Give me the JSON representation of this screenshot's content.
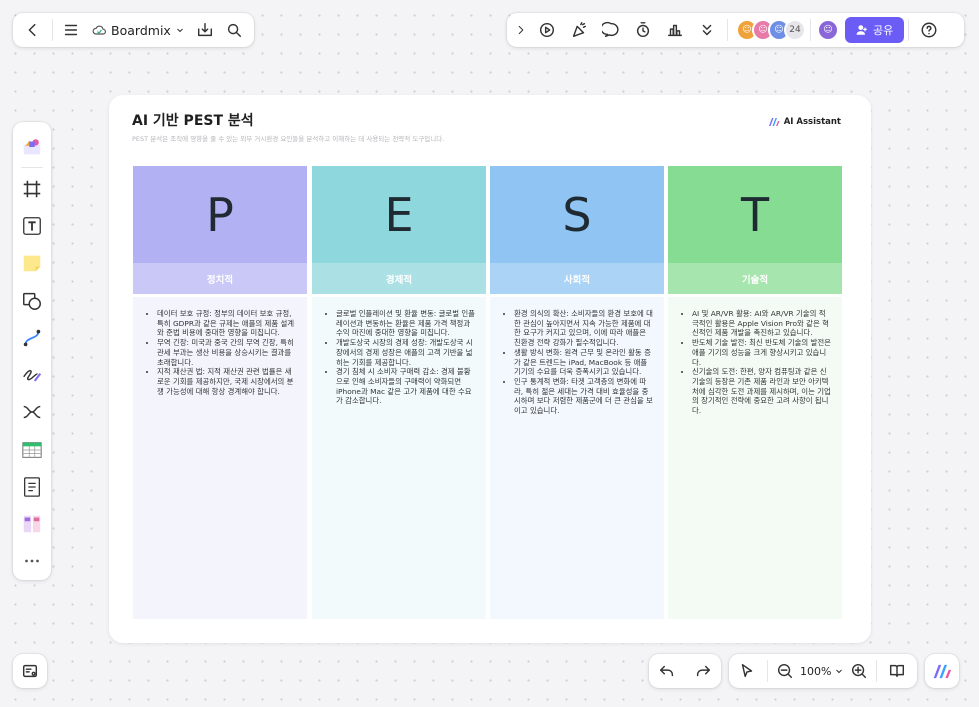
{
  "topbar": {
    "app_name": "Boardmix",
    "share_label": "공유",
    "collaborator_count": "24"
  },
  "board": {
    "title": "AI 기반 PEST 분석",
    "subtitle": "PEST 분석은 조직에 영향을 줄 수 있는 외부 거시환경 요인들을 분석하고 이해하는 데 사용되는 전략적 도구입니다.",
    "ai_label": "AI Assistant",
    "columns": [
      {
        "letter": "P",
        "label": "정치적",
        "colors": {
          "head": "#b2b1f3",
          "sub": "#c9c8f6",
          "body": "#f4f4fd"
        },
        "items": [
          "데이터 보호 규정: 정부의 데이터 보호 규정, 특히 GDPR과 같은 규제는 애플의 제품 설계와 준법 비용에 중대한 영향을 미칩니다.",
          "무역 긴장: 미국과 중국 간의 무역 긴장, 특히 관세 부과는 생산 비용을 상승시키는 결과를 초래합니다.",
          "지적 재산권 법: 지적 재산권 관련 법률은 새로운 기회를 제공하지만, 국제 시장에서의 분쟁 가능성에 대해 항상 경계해야 합니다."
        ]
      },
      {
        "letter": "E",
        "label": "경제적",
        "colors": {
          "head": "#8ed7dd",
          "sub": "#abe1e5",
          "body": "#f2fafb"
        },
        "items": [
          "글로벌 인플레이션 및 환율 변동: 글로벌 인플레이션과 변동하는 환율은 제품 가격 책정과 수익 마진에 중대한 영향을 미칩니다.",
          "개발도상국 시장의 경제 성장: 개발도상국 시장에서의 경제 성장은 애플의 고객 기반을 넓히는 기회를 제공합니다.",
          "경기 침체 시 소비자 구매력 감소: 경제 불황으로 인해 소비자들의 구매력이 약화되면 iPhone과 Mac 같은 고가 제품에 대한 수요가 감소합니다."
        ]
      },
      {
        "letter": "S",
        "label": "사회적",
        "colors": {
          "head": "#8fc4f3",
          "sub": "#aad3f6",
          "body": "#f3f8fe"
        },
        "items": [
          "환경 의식의 확산: 소비자들의 환경 보호에 대한 관심이 높아지면서 지속 가능한 제품에 대한 요구가 커지고 있으며, 이에 따라 애플은 친환경 전략 강화가 필수적입니다.",
          "생활 방식 변화: 원격 근무 및 온라인 활동 증가 같은 트렌드는 iPad, MacBook 등 애플 기기의 수요를 더욱 증폭시키고 있습니다.",
          "인구 통계적 변화: 타겟 고객층의 변화에 따라, 특히 젊은 세대는 가격 대비 효율성을 중시하며 보다 저렴한 제품군에 더 큰 관심을 보이고 있습니다."
        ]
      },
      {
        "letter": "T",
        "label": "기술적",
        "colors": {
          "head": "#86dc93",
          "sub": "#a6e5ae",
          "body": "#f3fbf4"
        },
        "items": [
          "AI 및 AR/VR 활용: AI와 AR/VR 기술의 적극적인 활용은 Apple Vision Pro와 같은 혁신적인 제품 개발을 촉진하고 있습니다.",
          "반도체 기술 발전: 최신 반도체 기술의 발전은 애플 기기의 성능을 크게 향상시키고 있습니다.",
          "신기술의 도전: 한편, 양자 컴퓨팅과 같은 신기술의 등장은 기존 제품 라인과 보안 아키텍처에 심각한 도전 과제를 제시하며, 이는 기업의 장기적인 전략에 중요한 고려 사항이 됩니다."
        ]
      }
    ]
  },
  "bottom": {
    "zoom": "100%"
  },
  "colors": {
    "accent": "#6b5cf6",
    "background": "#f4f4f6"
  }
}
